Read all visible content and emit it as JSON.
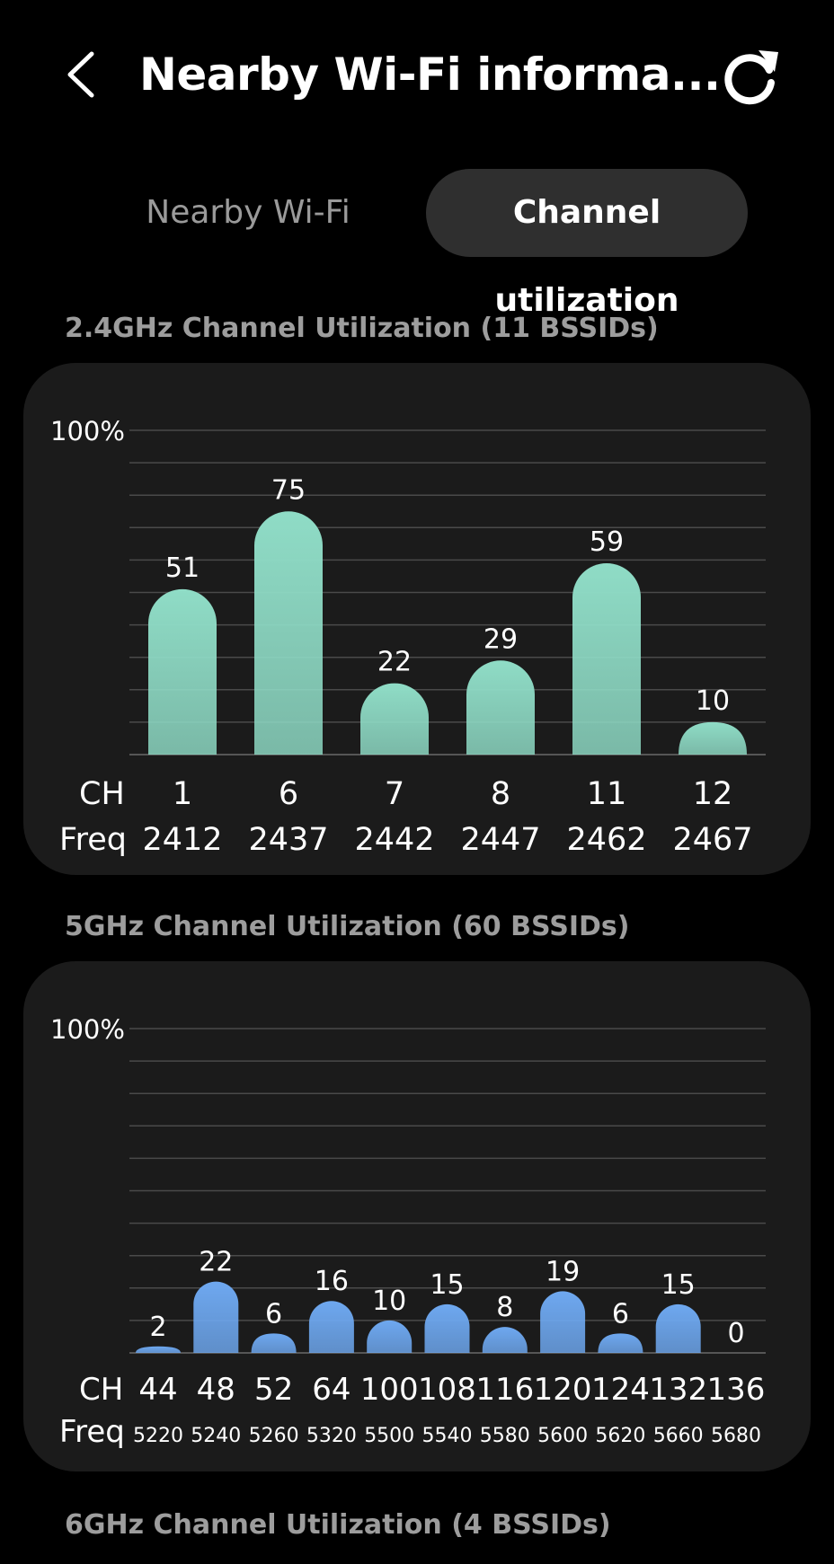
{
  "header": {
    "title": "Nearby Wi-Fi informa...",
    "back_icon": "chevron-left-icon",
    "refresh_icon": "refresh-icon"
  },
  "tabs": [
    {
      "label": "Nearby Wi-Fi",
      "active": false
    },
    {
      "label": "Channel utilization",
      "active": true
    }
  ],
  "sections": {
    "ghz24_title": "2.4GHz Channel Utilization (11 BSSIDs)",
    "ghz5_title": "5GHz Channel Utilization (60 BSSIDs)",
    "ghz6_title": "6GHz Channel Utilization (4 BSSIDs)"
  },
  "colors": {
    "bar_24": "#8fdcc6",
    "bar_5": "#6ea8f0",
    "card_bg": "#1b1b1b",
    "tab_active_bg": "#2f2f2f"
  },
  "chart_data": [
    {
      "type": "bar",
      "title": "2.4GHz Channel Utilization (11 BSSIDs)",
      "y_top_label": "100%",
      "ylim": [
        0,
        100
      ],
      "row_labels": [
        "CH",
        "Freq"
      ],
      "categories": [
        "1",
        "6",
        "7",
        "8",
        "11",
        "12"
      ],
      "freq": [
        "2412",
        "2437",
        "2442",
        "2447",
        "2462",
        "2467"
      ],
      "values": [
        51,
        75,
        22,
        29,
        59,
        10
      ],
      "grid": true
    },
    {
      "type": "bar",
      "title": "5GHz Channel Utilization (60 BSSIDs)",
      "y_top_label": "100%",
      "ylim": [
        0,
        100
      ],
      "row_labels": [
        "CH",
        "Freq"
      ],
      "categories": [
        "44",
        "48",
        "52",
        "64",
        "100",
        "108",
        "116",
        "120",
        "124",
        "132",
        "136"
      ],
      "freq": [
        "5220",
        "5240",
        "5260",
        "5320",
        "5500",
        "5540",
        "5580",
        "5600",
        "5620",
        "5660",
        "5680"
      ],
      "values": [
        2,
        22,
        6,
        16,
        10,
        15,
        8,
        19,
        6,
        15,
        0
      ],
      "grid": true
    }
  ]
}
